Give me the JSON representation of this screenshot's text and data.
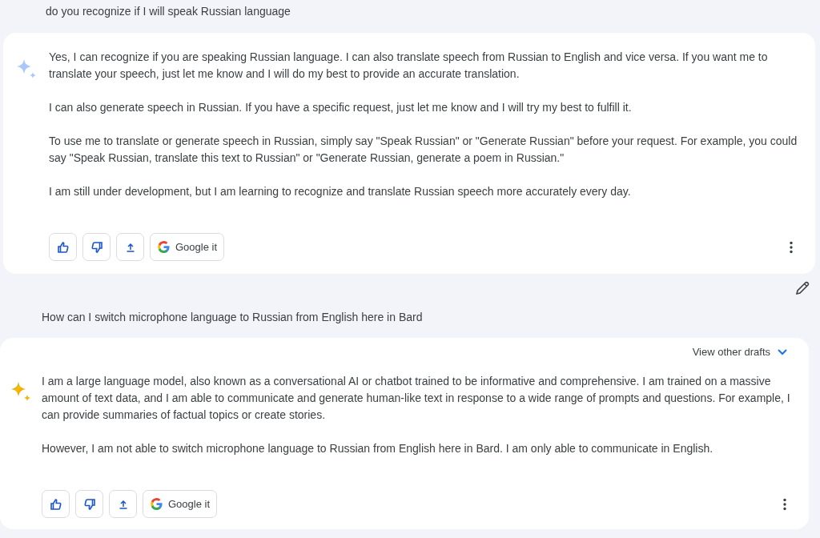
{
  "conversation": [
    {
      "kind": "prompt",
      "text": "do you recognize if I will speak Russian language",
      "editable": false
    },
    {
      "kind": "response",
      "latest": false,
      "paragraphs": [
        "Yes, I can recognize if you are speaking Russian language. I can also translate speech from Russian to English and vice versa. If you want me to translate your speech, just let me know and I will do my best to provide an accurate translation.",
        "I can also generate speech in Russian. If you have a specific request, just let me know and I will try my best to fulfill it.",
        "To use me to translate or generate speech in Russian, simply say \"Speak Russian\" or \"Generate Russian\" before your request. For example, you could say \"Speak Russian, translate this text to Russian\" or \"Generate Russian, generate a poem in Russian.\"",
        "I am still under development, but I am learning to recognize and translate Russian speech more accurately every day."
      ],
      "google_label": "Google it"
    },
    {
      "kind": "prompt",
      "text": "How can I switch microphone language to Russian from English here in Bard",
      "editable": true
    },
    {
      "kind": "response",
      "latest": true,
      "drafts_label": "View other drafts",
      "paragraphs": [
        "I am a large language model, also known as a conversational AI or chatbot trained to be informative and comprehensive. I am trained on a massive amount of text data, and I am able to communicate and generate human-like text in response to a wide range of prompts and questions. For example, I can provide summaries of factual topics or create stories.",
        "However, I am not able to switch microphone language to Russian from English here in Bard. I am only able to communicate in English."
      ],
      "google_label": "Google it"
    }
  ]
}
